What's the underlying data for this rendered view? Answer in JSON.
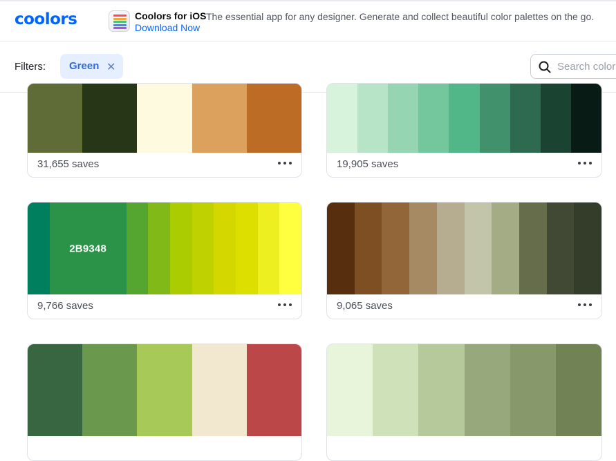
{
  "promo": {
    "logo": "coolors",
    "title": "Coolors for iOS",
    "description": "The essential app for any designer. Generate and collect beautiful color palettes on the go.",
    "link": "Download Now",
    "icon_strip_colors": [
      "#f44c5a",
      "#f7a63b",
      "#4ec07f",
      "#3f87f4",
      "#9c59e6"
    ]
  },
  "filters": {
    "label": "Filters:",
    "chip_label": "Green",
    "chip_remove": "✕",
    "search_placeholder": "Search colors"
  },
  "palettes": [
    {
      "colors": [
        "#606c38",
        "#283618",
        "#fefae0",
        "#dda15e",
        "#bc6c25"
      ],
      "saves": "31,655 saves"
    },
    {
      "colors": [
        "#d8f3dc",
        "#b7e4c7",
        "#95d5b2",
        "#74c69d",
        "#52b788",
        "#40916c",
        "#2d6a4f",
        "#1b4332",
        "#081c15"
      ],
      "saves": "19,905 saves"
    },
    {
      "colors": [
        "#007f5f",
        "#2b9348",
        "#55a630",
        "#80b918",
        "#aacc00",
        "#bfd200",
        "#d4d700",
        "#dddf00",
        "#eeef20",
        "#ffff3f"
      ],
      "saves": "9,766 saves",
      "hovered_hex": "2B9348"
    },
    {
      "colors": [
        "#582f0e",
        "#7f4f24",
        "#936639",
        "#a68a64",
        "#b6ad90",
        "#c2c5aa",
        "#a4ac86",
        "#656d4a",
        "#414833",
        "#333d29"
      ],
      "saves": "9,065 saves"
    },
    {
      "colors": [
        "#386641",
        "#6a994e",
        "#a7c957",
        "#f2e8cf",
        "#bc4749"
      ],
      "saves": ""
    },
    {
      "colors": [
        "#e9f5db",
        "#cfe1b9",
        "#b5c99a",
        "#97a97c",
        "#87986a",
        "#718355"
      ],
      "saves": ""
    }
  ],
  "more_menu_label": "More options"
}
